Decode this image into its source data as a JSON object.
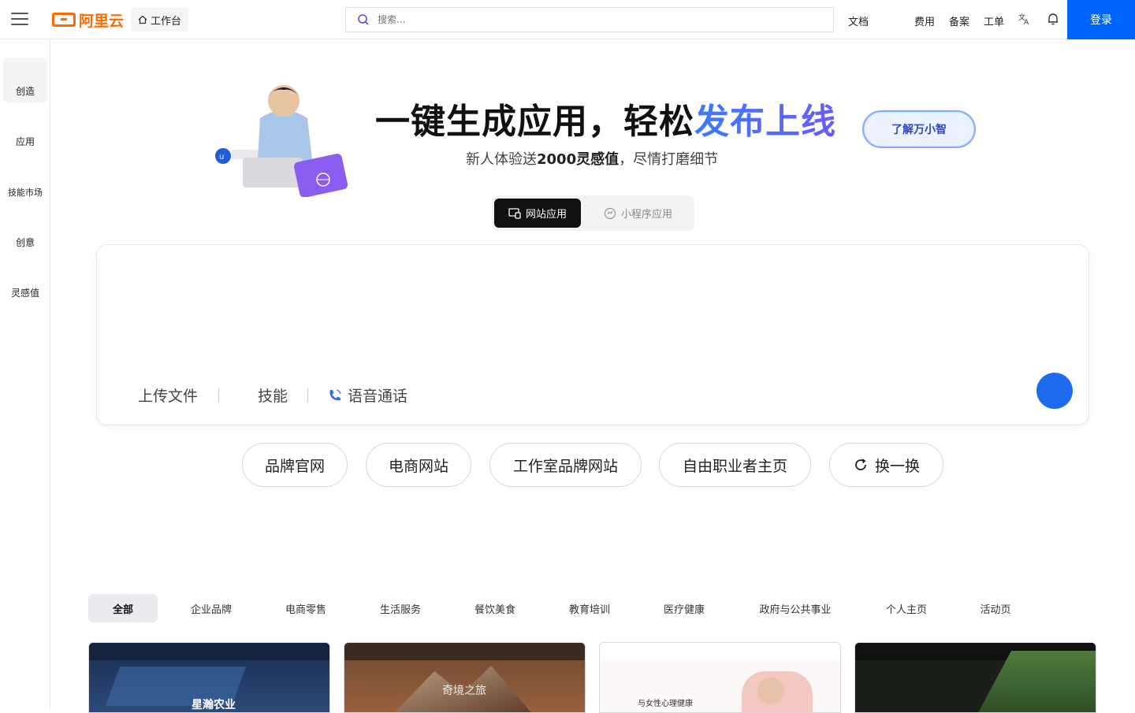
{
  "header": {
    "logo_text": "阿里云",
    "workbench_label": "工作台",
    "search_placeholder": "搜索...",
    "links": {
      "docs": "文档",
      "billing": "费用",
      "icp": "备案",
      "ticket": "工单"
    },
    "login_label": "登录"
  },
  "sidebar": {
    "items": [
      {
        "label": "创造"
      },
      {
        "label": "应用"
      },
      {
        "label": "技能市场"
      },
      {
        "label": "创意"
      },
      {
        "label": "灵感值"
      }
    ]
  },
  "hero": {
    "title_part1": "一键生成应用，轻松",
    "title_highlight": "发布上线",
    "subtitle_pre": "新人体验送",
    "subtitle_bold": "2000灵感值",
    "subtitle_post": "，尽情打磨细节",
    "learn_button": "了解万小智"
  },
  "mode_toggle": {
    "website": "网站应用",
    "miniprogram": "小程序应用"
  },
  "prompt": {
    "placeholder": "",
    "upload": "上传文件",
    "skills": "技能",
    "voice": "语音通话"
  },
  "suggestions": [
    "品牌官网",
    "电商网站",
    "工作室品牌网站",
    "自由职业者主页",
    "换一换"
  ],
  "categories": [
    "全部",
    "企业品牌",
    "电商零售",
    "生活服务",
    "餐饮美食",
    "教育培训",
    "医疗健康",
    "政府与公共事业",
    "个人主页",
    "活动页"
  ],
  "templates": [
    {
      "title": "星瀚农业"
    },
    {
      "title": "奇境之旅"
    },
    {
      "title": "与女性心理健康"
    },
    {
      "title": ""
    }
  ],
  "colors": {
    "brand_orange": "#ff6a00",
    "primary_blue": "#0064fa"
  }
}
